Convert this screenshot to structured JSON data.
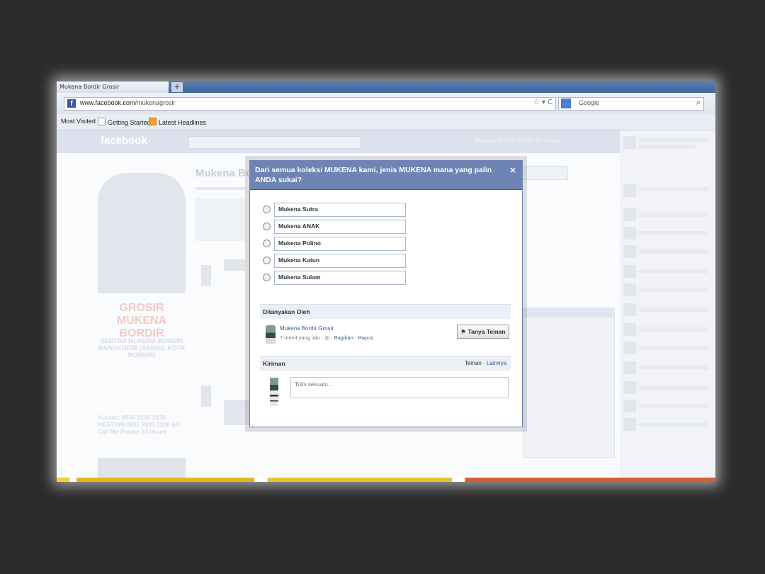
{
  "browser": {
    "tab_title": "Mukena Bordir Grosir",
    "new_tab_label": "+",
    "url_host": "www.facebook.com",
    "url_path": "/mukenagrosir",
    "url_controls": "☆ ▾ C",
    "search_engine": "Google",
    "bookmarks": [
      "Most Visited",
      "Getting Started",
      "Latest Headlines"
    ]
  },
  "facebook": {
    "logo": "facebook",
    "user_area": "Mukena Bordir Grosir   Beranda",
    "page_title": "Mukena Bo",
    "brand_text": "GROSIR MUKENA BORDIR",
    "sidebar_text": "SENTRA MUKENA BORDIR BANGKODIR (BANGIL KOTA BORDIR)",
    "contact": "Kontak: 0856 1515 1933 MENTARI 0852 8933 2200 AS Call Me Please 24 Hours"
  },
  "dialog": {
    "title": "Dari semua koleksi MUKENA kami, jenis MUKENA mana yang palin ANDA sukai?",
    "close": "×",
    "options": [
      "Mukena Sutra",
      "Mukena ANAK",
      "Mukena Polino",
      "Mukena Katun",
      "Mukena Sulam"
    ],
    "asked_by_heading": "Ditanyakan Oleh",
    "asker_name": "Mukena Bordir Grosir",
    "asker_time": "7 menit yang lalu",
    "asker_share": "Bagikan",
    "asker_delete": "Hapus",
    "ask_friends_button": "Tanya Teman",
    "posts_heading": "Kiriman",
    "posts_link_friends": "Teman",
    "posts_link_more": "Lainnya",
    "post_placeholder": "Tulis sesuatu..."
  },
  "colors": {
    "fb_blue": "#3b5998",
    "dialog_header": "#6d84b4",
    "background": "#2b2b2b"
  }
}
